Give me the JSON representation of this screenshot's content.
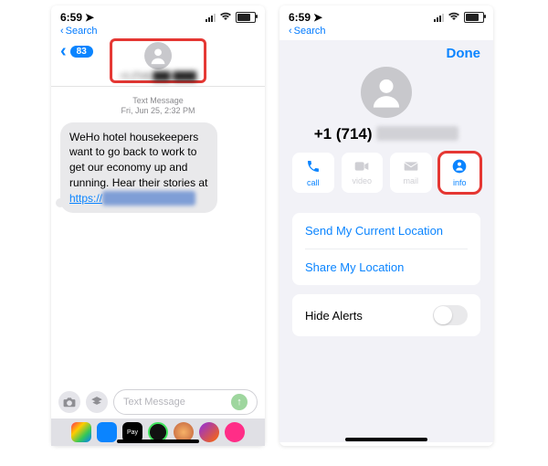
{
  "colors": {
    "accent": "#0a84ff",
    "highlight": "#e53733",
    "bubble": "#e9e9eb",
    "groupbg": "#f2f2f7"
  },
  "status": {
    "time": "6:59",
    "loc_arrow": "➚"
  },
  "searchrow": {
    "label": "Search"
  },
  "left": {
    "back_count": "83",
    "contact_number": "+1 (714) ███-████",
    "meta_line1": "Text Message",
    "meta_line2": "Fri, Jun 25, 2:32 PM",
    "message_text": "WeHo hotel housekeepers want to go back to work to get our economy up and running. Hear their stories at ",
    "message_link_visible": "https://",
    "message_link_hidden": "████████████",
    "compose_placeholder": "Text Message"
  },
  "right": {
    "done": "Done",
    "contact_number_prefix": "+1 (714)",
    "actions": [
      {
        "id": "call",
        "label": "call",
        "enabled": true
      },
      {
        "id": "video",
        "label": "video",
        "enabled": false
      },
      {
        "id": "mail",
        "label": "mail",
        "enabled": false
      },
      {
        "id": "info",
        "label": "info",
        "enabled": true
      }
    ],
    "send_current": "Send My Current Location",
    "share_loc": "Share My Location",
    "hide_alerts": "Hide Alerts",
    "hide_alerts_on": false
  }
}
